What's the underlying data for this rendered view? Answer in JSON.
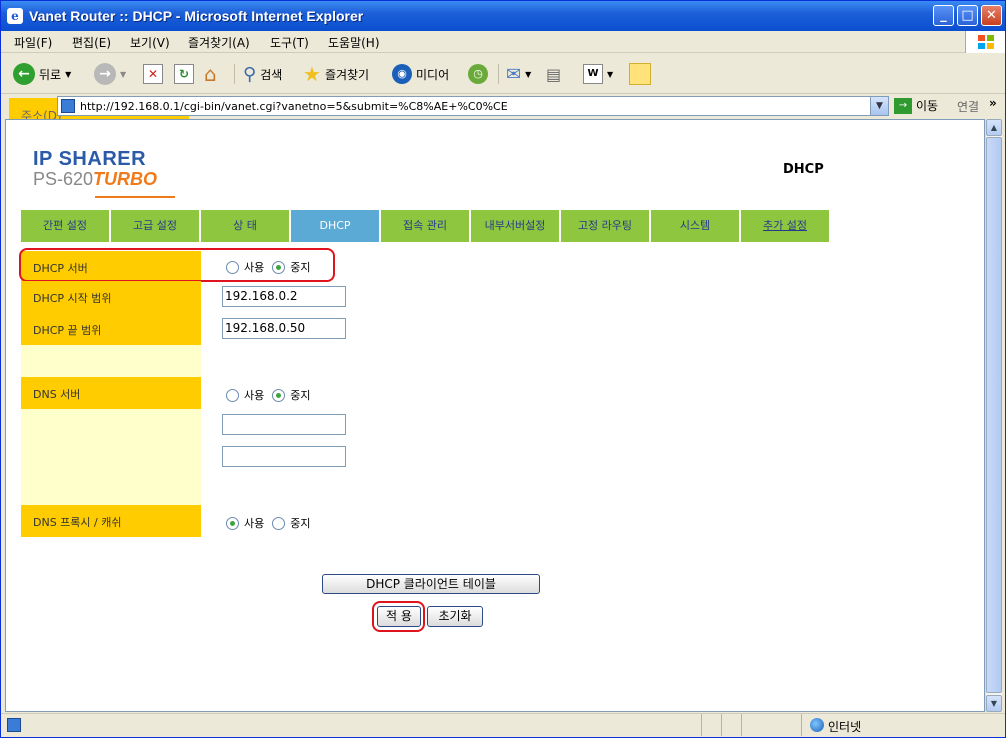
{
  "window": {
    "title": "Vanet Router :: DHCP - Microsoft Internet Explorer"
  },
  "menu": [
    "파일(F)",
    "편집(E)",
    "보기(V)",
    "즐겨찾기(A)",
    "도구(T)",
    "도움말(H)"
  ],
  "toolbar": {
    "back": "뒤로",
    "search": "검색",
    "favorites": "즐겨찾기",
    "media": "미디어"
  },
  "address": {
    "label": "주소(D)",
    "url": "http://192.168.0.1/cgi-bin/vanet.cgi?vanetno=5&submit=%C8%AE+%C0%CE",
    "go": "이동",
    "links": "연결"
  },
  "logo": {
    "line1": "IP SHARER",
    "model": "PS-620",
    "turbo": "TURBO"
  },
  "page_title": "DHCP",
  "nav": [
    "간편 설정",
    "고급 설정",
    "상 태",
    "DHCP",
    "접속 관리",
    "내부서버설정",
    "고정 라우팅",
    "시스템",
    "추가 설정"
  ],
  "form": {
    "dhcp_server": {
      "label": "DHCP 서버",
      "opt_use": "사용",
      "opt_stop": "중지",
      "selected": "중지"
    },
    "start_range": {
      "label": "DHCP 시작 범위",
      "value": "192.168.0.2"
    },
    "end_range": {
      "label": "DHCP 끝 범위",
      "value": "192.168.0.50"
    },
    "dns_server": {
      "label": "DNS 서버",
      "opt_use": "사용",
      "opt_stop": "중지",
      "selected": "중지",
      "dns1": "",
      "dns2": ""
    },
    "dns_proxy": {
      "label": "DNS 프록시 / 캐쉬",
      "opt_use": "사용",
      "opt_stop": "중지",
      "selected": "사용"
    }
  },
  "buttons": {
    "client_table": "DHCP 클라이언트 테이블",
    "apply": "적 용",
    "reset": "초기화"
  },
  "status": {
    "zone": "인터넷"
  }
}
